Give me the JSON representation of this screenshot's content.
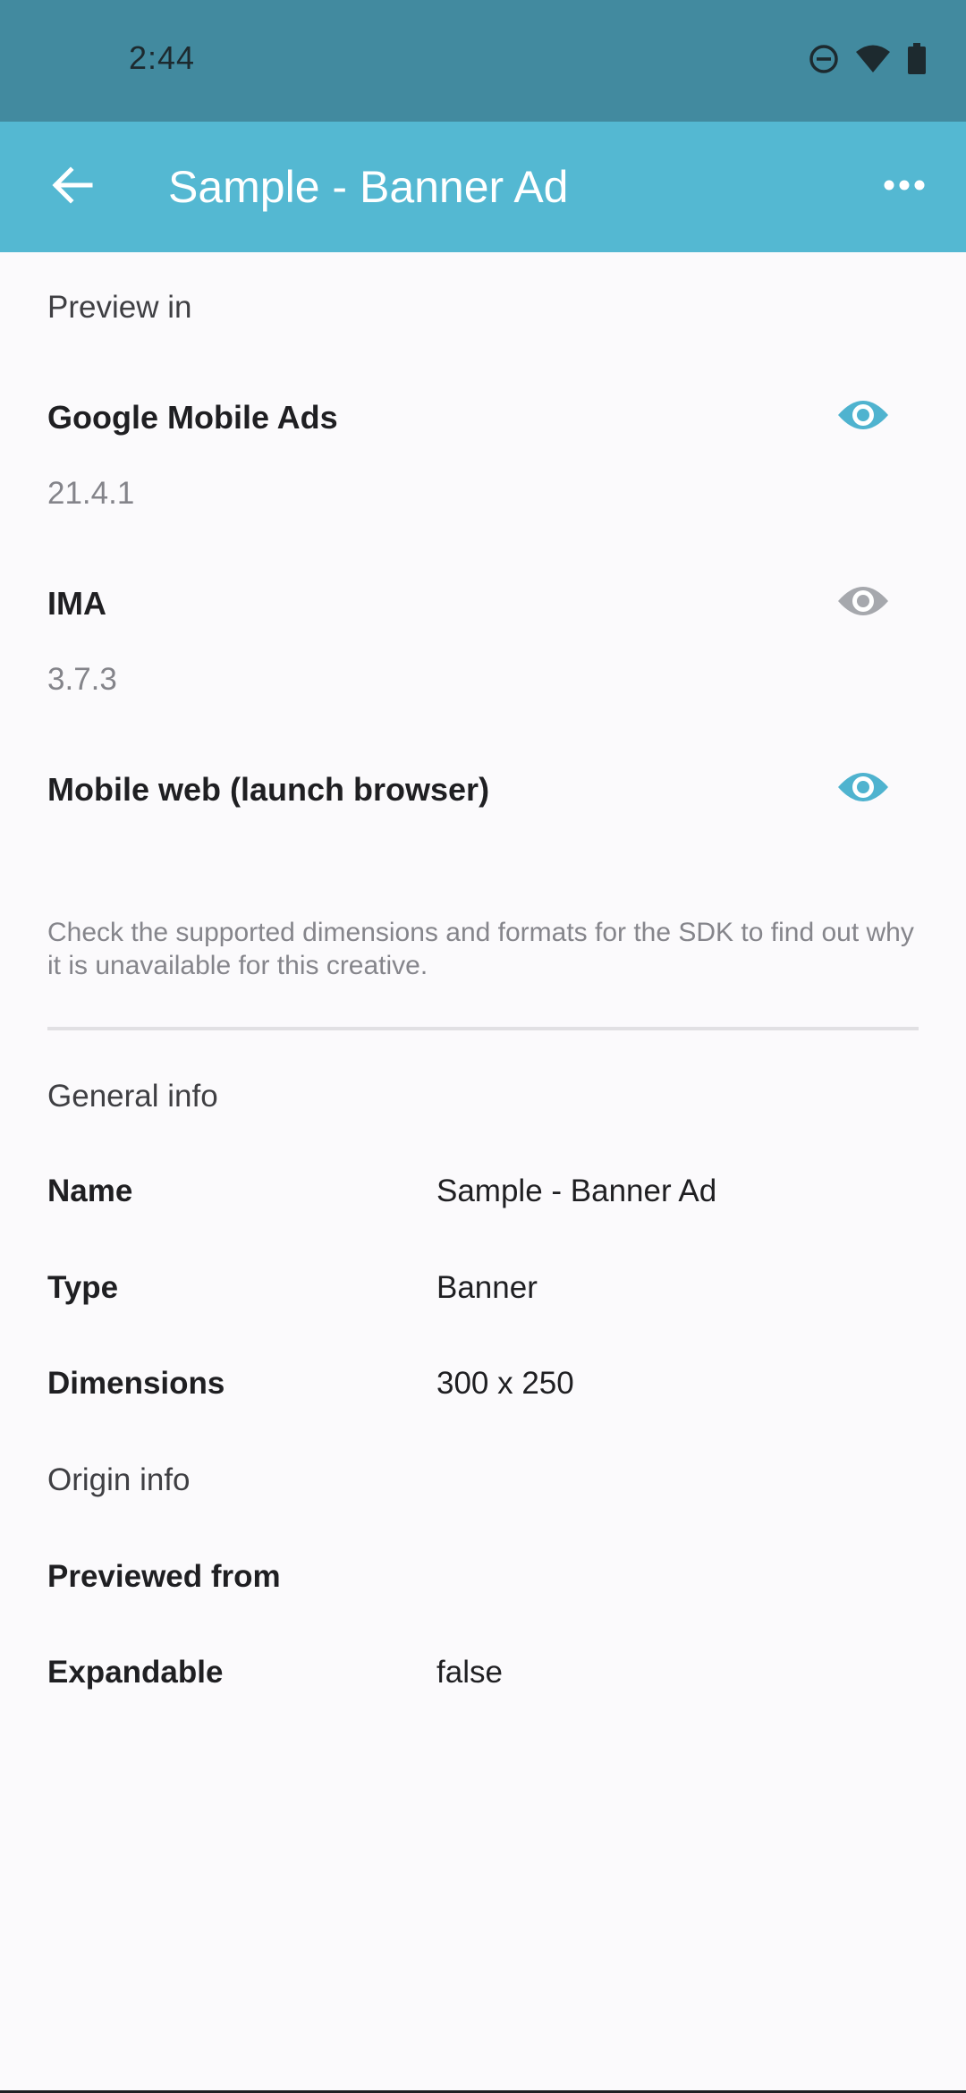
{
  "status_bar": {
    "time": "2:44",
    "icons": [
      "do-not-disturb-icon",
      "wifi-icon",
      "battery-icon"
    ]
  },
  "app_bar": {
    "title": "Sample - Banner Ad",
    "back_icon": "arrow-left-icon",
    "more_icon": "more-horizontal-icon",
    "background": "#54b8d2"
  },
  "preview": {
    "section_title": "Preview in",
    "sdks": [
      {
        "name": "Google Mobile Ads",
        "version": "21.4.1",
        "enabled": true
      },
      {
        "name": "IMA",
        "version": "3.7.3",
        "enabled": false
      },
      {
        "name": "Mobile web (launch browser)",
        "version": "",
        "enabled": true
      }
    ],
    "help_text": "Check the supported dimensions and formats for the SDK to find out why it is unavailable for this creative."
  },
  "general_info": {
    "section_title": "General info",
    "rows": [
      {
        "label": "Name",
        "value": "Sample - Banner Ad"
      },
      {
        "label": "Type",
        "value": "Banner"
      },
      {
        "label": "Dimensions",
        "value": "300 x 250"
      }
    ]
  },
  "origin_info": {
    "section_title": "Origin info",
    "rows": [
      {
        "label": "Previewed from",
        "value": ""
      },
      {
        "label": "Expandable",
        "value": "false"
      }
    ]
  },
  "colors": {
    "status_bar": "#428a9f",
    "accent": "#54b8d2",
    "eye_enabled": "#4fb3cf",
    "eye_disabled": "#a6a8ad"
  }
}
